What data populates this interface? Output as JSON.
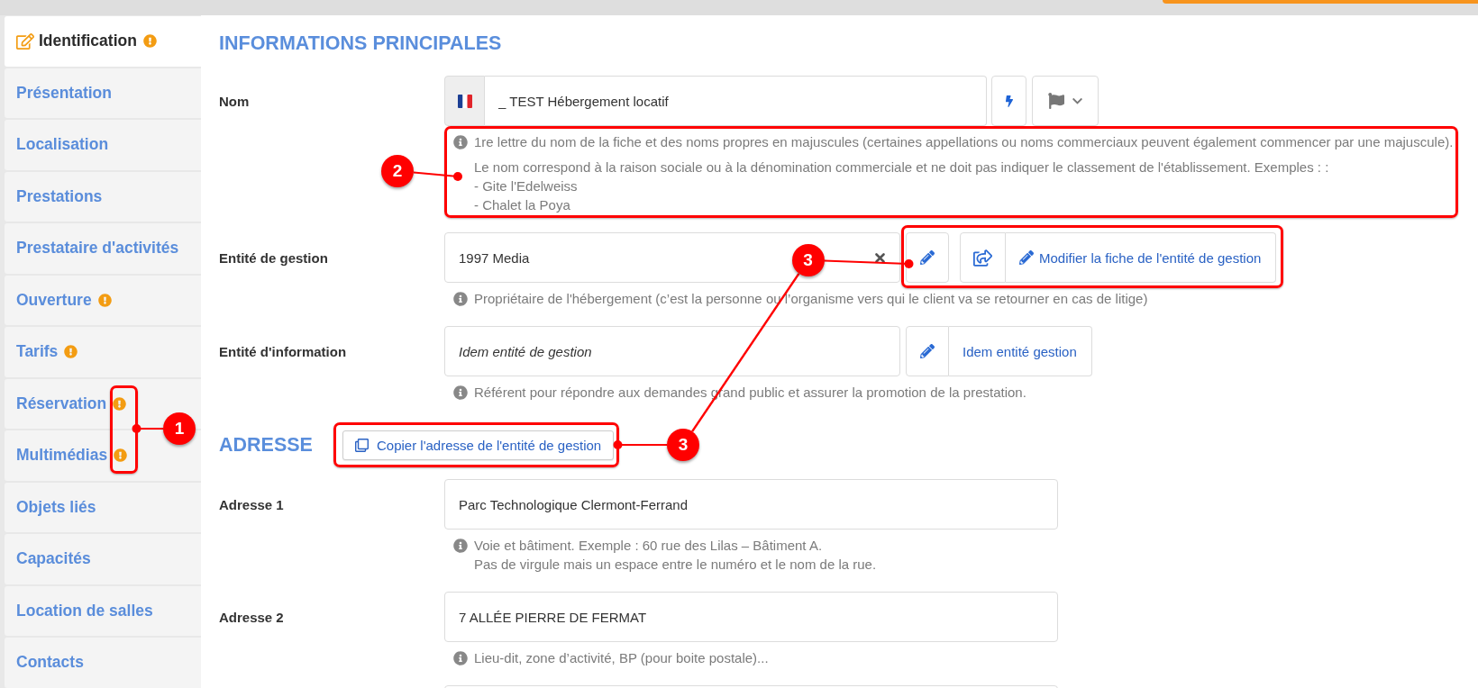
{
  "sidebar": {
    "items": [
      {
        "label": "Identification",
        "selected": true,
        "warning": true
      },
      {
        "label": "Présentation",
        "selected": false,
        "warning": false
      },
      {
        "label": "Localisation",
        "selected": false,
        "warning": false
      },
      {
        "label": "Prestations",
        "selected": false,
        "warning": false
      },
      {
        "label": "Prestataire d'activités",
        "selected": false,
        "warning": false
      },
      {
        "label": "Ouverture",
        "selected": false,
        "warning": true
      },
      {
        "label": "Tarifs",
        "selected": false,
        "warning": true
      },
      {
        "label": "Réservation",
        "selected": false,
        "warning": true
      },
      {
        "label": "Multimédias",
        "selected": false,
        "warning": true
      },
      {
        "label": "Objets liés",
        "selected": false,
        "warning": false
      },
      {
        "label": "Capacités",
        "selected": false,
        "warning": false
      },
      {
        "label": "Location de salles",
        "selected": false,
        "warning": false
      },
      {
        "label": "Contacts",
        "selected": false,
        "warning": false
      }
    ]
  },
  "sections": [
    {
      "title": "INFORMATIONS PRINCIPALES",
      "fields": [
        {
          "kind": "name",
          "label": "Nom",
          "value": "_ TEST Hébergement locatif",
          "help": [
            [
              "1re lettre du nom de la fiche et des noms propres en majuscules (certaines appellations ou noms commerciaux peuvent également commencer par une majuscule)."
            ],
            [
              "Le nom correspond à la raison sociale ou à la dénomination commerciale et ne doit pas indiquer le classement de l'établissement. Exemples : :",
              "- Gite l'Edelweiss",
              "- Chalet la Poya"
            ]
          ]
        },
        {
          "kind": "entity",
          "label": "Entité de gestion",
          "value": "1997 Media",
          "clearable": true,
          "button_groups": [
            [
              {
                "kind": "edit"
              }
            ],
            [
              {
                "kind": "open"
              },
              {
                "kind": "edit",
                "label": "Modifier la fiche de l'entité de gestion"
              }
            ]
          ],
          "help": [
            [
              "Propriétaire de l'hébergement (c’est la personne ou l’organisme vers qui le client va se retourner en cas de litige)"
            ]
          ]
        },
        {
          "kind": "entity",
          "label": "Entité d'information",
          "placeholder": "Idem entité de gestion",
          "clearable": false,
          "button_groups": [
            [
              {
                "kind": "edit"
              },
              {
                "kind": "link",
                "label": "Idem entité gestion"
              }
            ]
          ],
          "help": [
            [
              "Référent pour répondre aux demandes grand public et assurer la promotion de la prestation."
            ]
          ]
        }
      ]
    },
    {
      "title": "ADRESSE",
      "button": "Copier l'adresse de l'entité de gestion",
      "fields": [
        {
          "kind": "address",
          "label": "Adresse 1",
          "value": "Parc Technologique Clermont-Ferrand",
          "help": [
            [
              "Voie et bâtiment. Exemple : 60 rue des Lilas – Bâtiment A.",
              "Pas de virgule mais un espace entre le numéro et le nom de la rue."
            ]
          ]
        },
        {
          "kind": "address",
          "label": "Adresse 2",
          "value": "7 ALLÉE PIERRE DE FERMAT",
          "help": [
            [
              "Lieu-dit, zone d’activité, BP (pour boite postale)..."
            ]
          ]
        },
        {
          "kind": "address"
        }
      ]
    }
  ],
  "annotations": {
    "markers": [
      {
        "number": "1"
      },
      {
        "number": "2"
      },
      {
        "number": "3"
      },
      {
        "number": "3"
      }
    ]
  }
}
